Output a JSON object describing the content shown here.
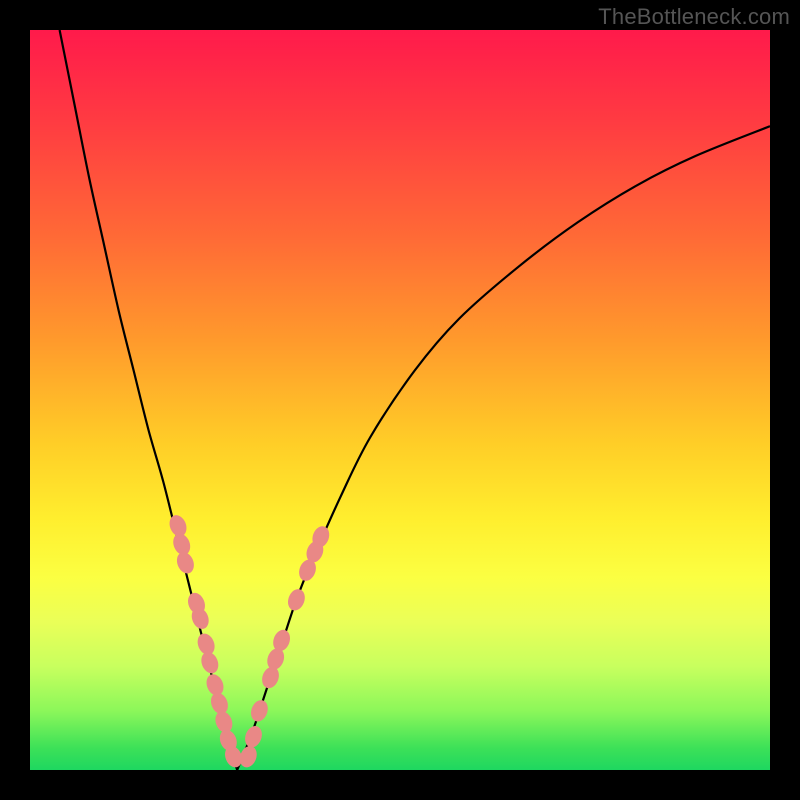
{
  "watermark": "TheBottleneck.com",
  "chart_data": {
    "type": "line",
    "title": "",
    "xlabel": "",
    "ylabel": "",
    "xlim": [
      0,
      100
    ],
    "ylim": [
      0,
      100
    ],
    "grid": false,
    "legend": false,
    "description": "Two smooth black curves descending from the top edge into a narrow V-shaped trough near x≈28 at y≈0, overlaid on a vertical red-to-green rainbow gradient. Salmon-colored bead markers are clustered along both branches in the lower portion of the V.",
    "series": [
      {
        "name": "left-branch",
        "x": [
          4,
          6,
          8,
          10,
          12,
          14,
          16,
          18,
          20,
          22,
          24,
          25,
          26,
          27,
          28
        ],
        "y": [
          100,
          90,
          80,
          71,
          62,
          54,
          46,
          39,
          31,
          23,
          15,
          11,
          7,
          3,
          0
        ]
      },
      {
        "name": "right-branch",
        "x": [
          28,
          30,
          32,
          34,
          36,
          38,
          42,
          46,
          52,
          58,
          66,
          74,
          82,
          90,
          100
        ],
        "y": [
          0,
          5,
          11,
          17,
          23,
          28,
          37,
          45,
          54,
          61,
          68,
          74,
          79,
          83,
          87
        ]
      }
    ],
    "beads_left": [
      {
        "x": 20.0,
        "y": 33.0
      },
      {
        "x": 20.5,
        "y": 30.5
      },
      {
        "x": 21.0,
        "y": 28.0
      },
      {
        "x": 22.5,
        "y": 22.5
      },
      {
        "x": 23.0,
        "y": 20.5
      },
      {
        "x": 23.8,
        "y": 17.0
      },
      {
        "x": 24.3,
        "y": 14.5
      },
      {
        "x": 25.0,
        "y": 11.5
      },
      {
        "x": 25.6,
        "y": 9.0
      },
      {
        "x": 26.2,
        "y": 6.5
      },
      {
        "x": 26.8,
        "y": 4.0
      },
      {
        "x": 27.5,
        "y": 1.8
      }
    ],
    "beads_right": [
      {
        "x": 29.5,
        "y": 1.8
      },
      {
        "x": 30.2,
        "y": 4.5
      },
      {
        "x": 31.0,
        "y": 8.0
      },
      {
        "x": 32.5,
        "y": 12.5
      },
      {
        "x": 33.2,
        "y": 15.0
      },
      {
        "x": 34.0,
        "y": 17.5
      },
      {
        "x": 36.0,
        "y": 23.0
      },
      {
        "x": 37.5,
        "y": 27.0
      },
      {
        "x": 38.5,
        "y": 29.5
      },
      {
        "x": 39.3,
        "y": 31.5
      }
    ],
    "colors": {
      "curve": "#000000",
      "bead": "#e98886",
      "gradient_top": "#ff1a4b",
      "gradient_bottom": "#1ed760"
    }
  }
}
